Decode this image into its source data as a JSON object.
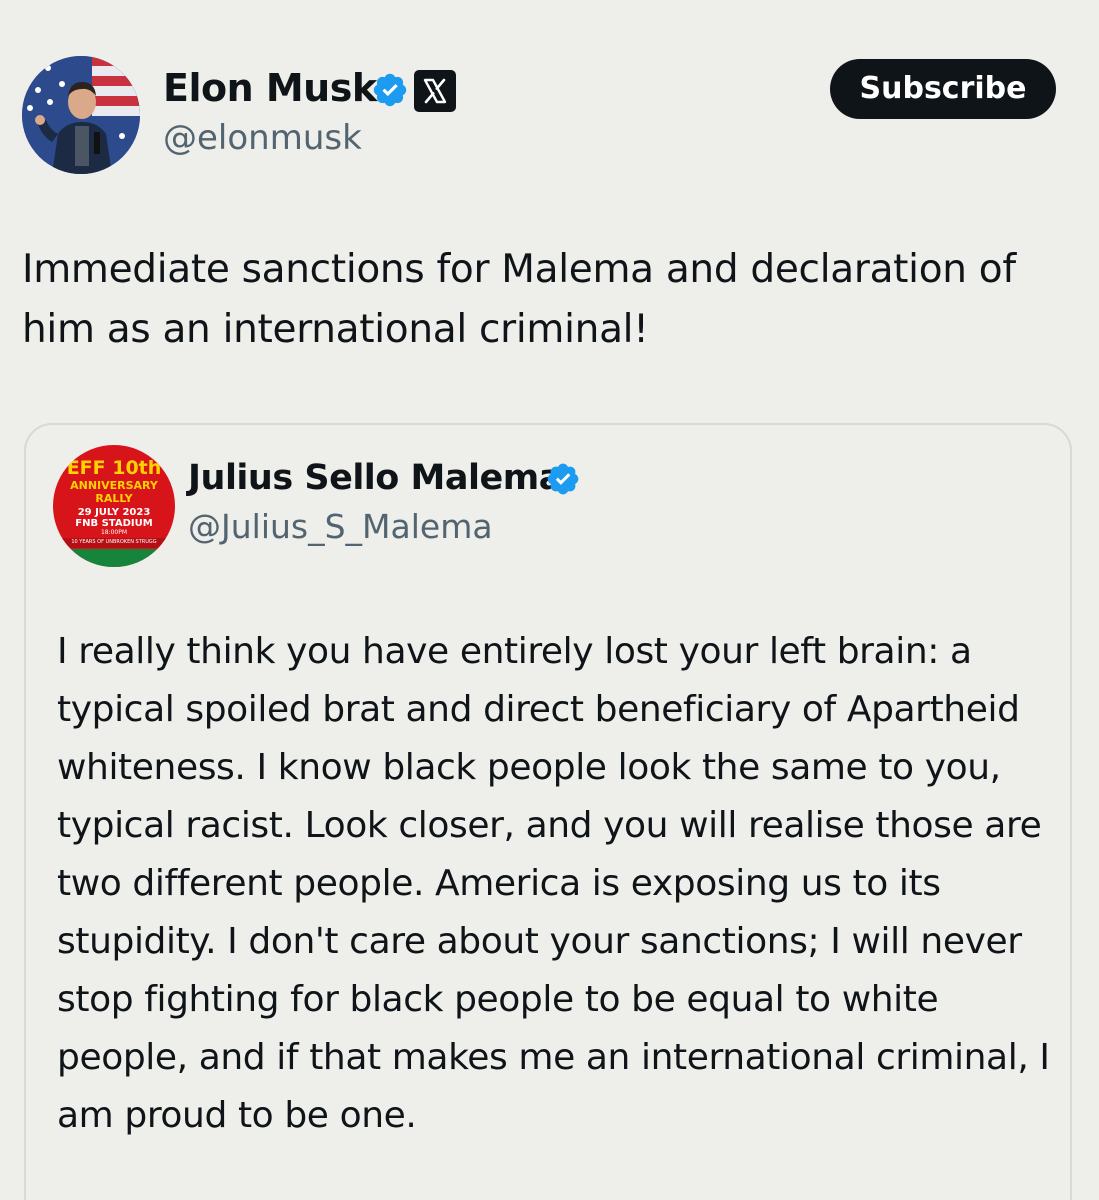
{
  "main_tweet": {
    "author_name": "Elon Musk",
    "handle": "@elonmusk",
    "subscribe_label": "Subscribe",
    "text": "Immediate sanctions for Malema and declaration of him as an international criminal!"
  },
  "quoted_tweet": {
    "author_name": "Julius Sello Malema",
    "handle": "@Julius_S_Malema",
    "avatar_text": {
      "line1": "EFF 10th",
      "line2": "ANNIVERSARY",
      "line3": "RALLY",
      "line4": "29 JULY 2023",
      "line5": "FNB STADIUM",
      "line6": "18:00PM",
      "line7": "10 YEARS OF UNBROKEN STRUGG"
    },
    "text": "I really think you have entirely lost your left brain: a typical spoiled brat and direct beneficiary of Apartheid whiteness. I know black people look the same to you, typical racist. Look closer, and you will realise those are two different people. America is exposing us to its stupidity. I don't care about your sanctions; I will never stop fighting for black people to be equal to white people, and if that makes me an international criminal, I am proud to be one."
  },
  "icons": {
    "verified": "verified-badge-icon",
    "platform": "x-logo-icon"
  },
  "colors": {
    "background": "#eeeeea",
    "verified_blue": "#1d9bf0",
    "handle_gray": "#536471",
    "button_dark": "#0f1419"
  }
}
